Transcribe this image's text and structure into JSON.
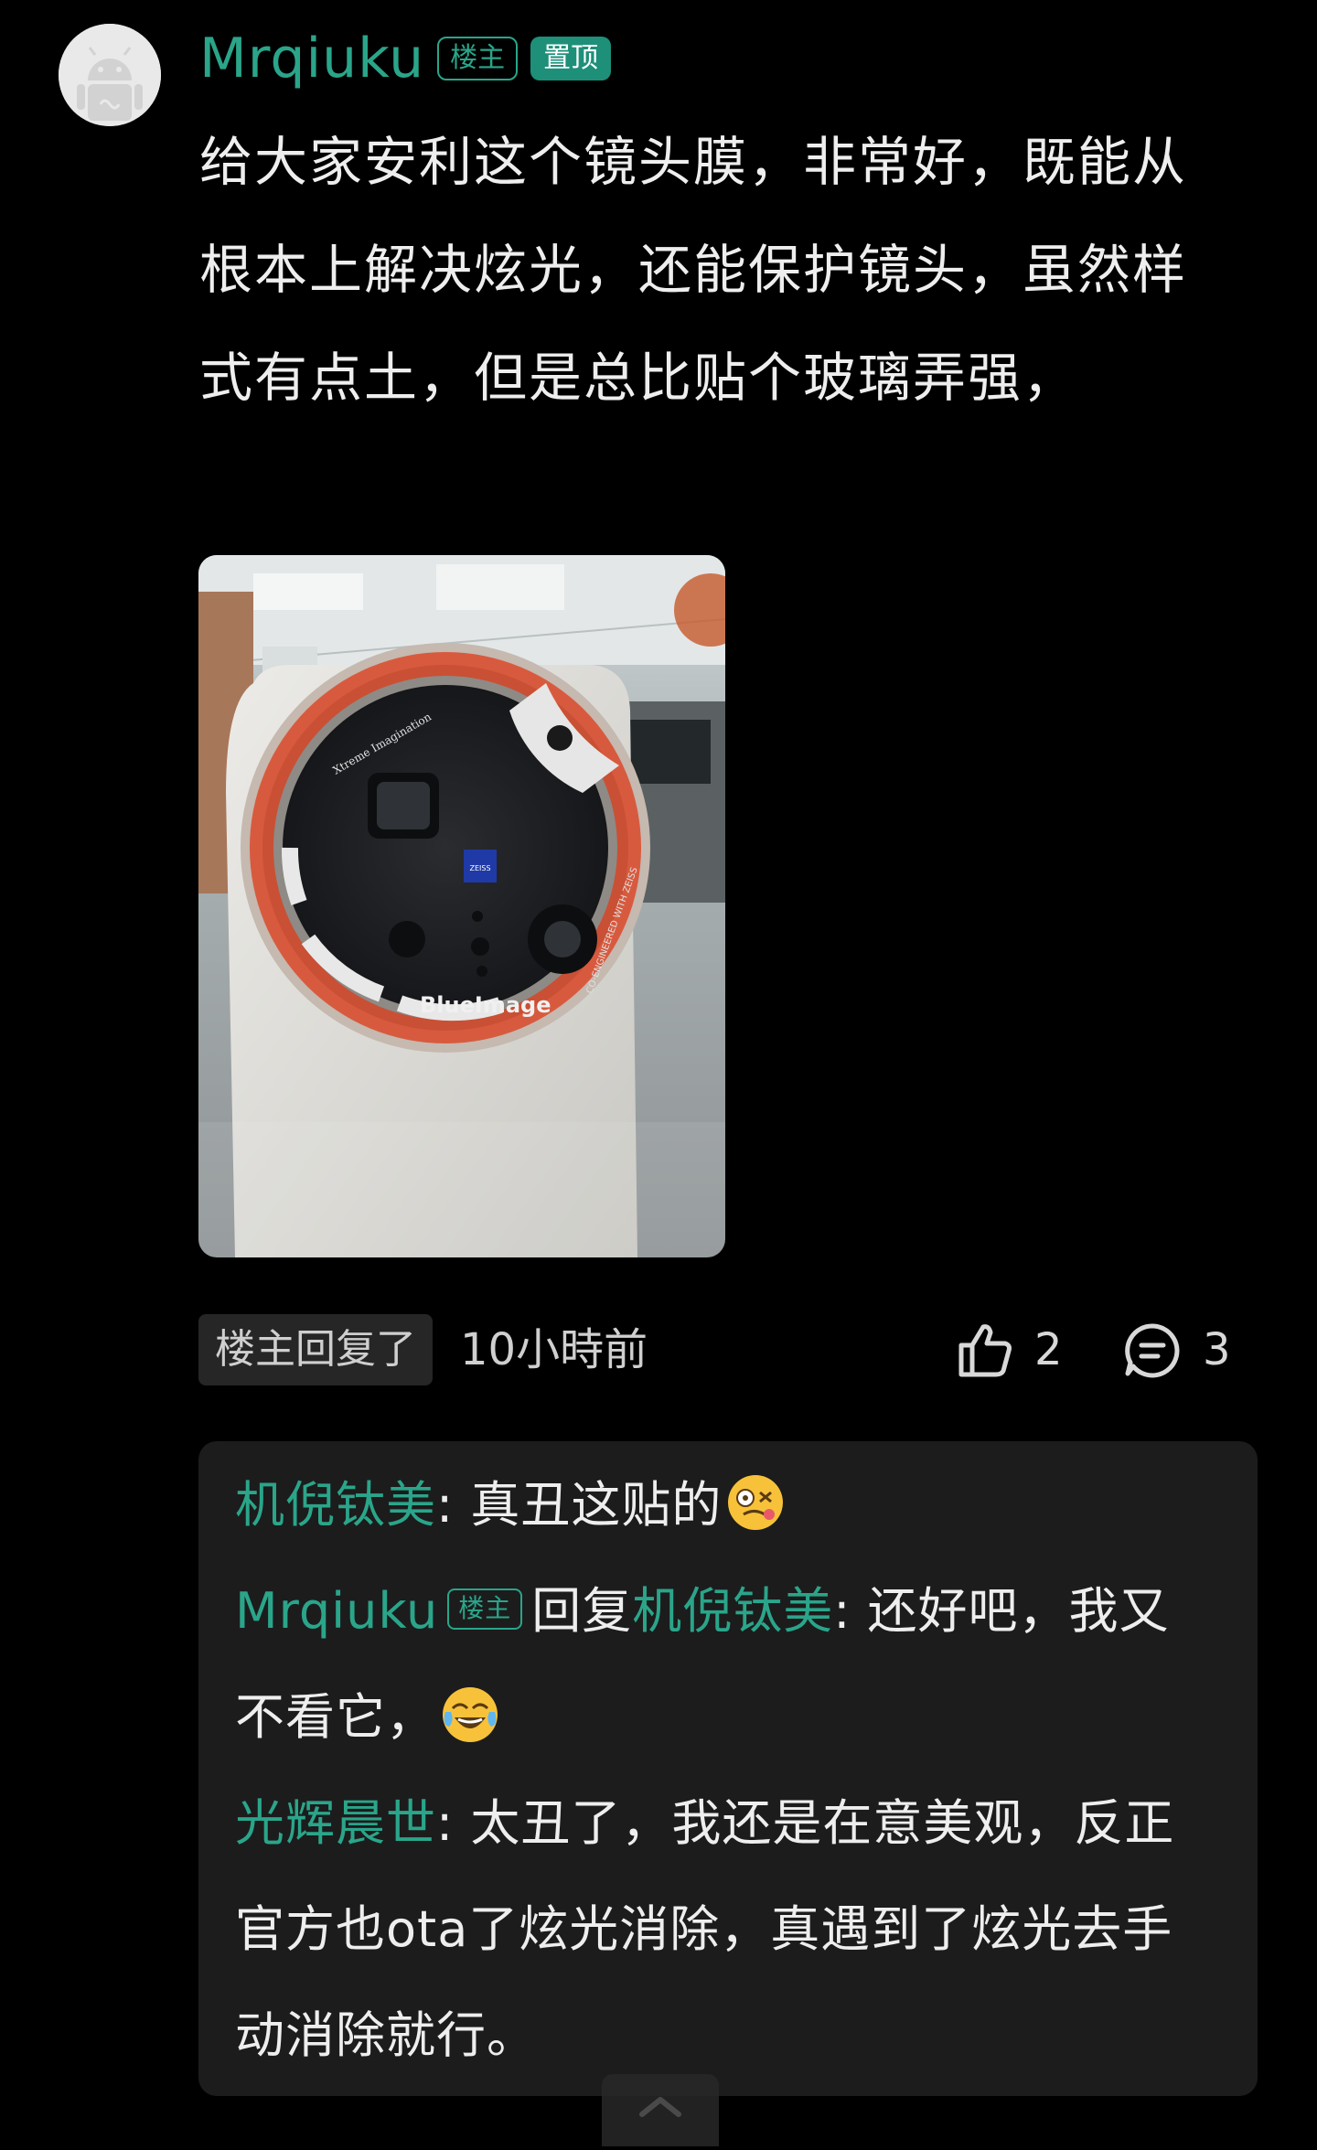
{
  "post": {
    "author": "Mrqiuku",
    "op_badge": "楼主",
    "pin_badge": "置顶",
    "text": "给大家安利这个镜头膜，非常好，既能从根本上解决炫光，还能保护镜头，虽然样式有点土，但是总比贴个玻璃弄强，"
  },
  "image_text": {
    "brand": "BlueImage",
    "zeiss": "ZEISS",
    "ring_top": "Xtreme Imagination",
    "ring_right": "CO-ENGINEERED WITH ZEISS"
  },
  "meta": {
    "op_replied": "楼主回复了",
    "time": "10小時前",
    "likes": "2",
    "comments": "3"
  },
  "replies": [
    {
      "user": "机倪钛美",
      "text": ": 真丑这贴的",
      "emoji": "dizzy-face-emoji"
    },
    {
      "user": "Mrqiuku",
      "badge": "楼主",
      "reply_word": "回复",
      "reply_to": "机倪钛美",
      "text": ": 还好吧，我又不看它，",
      "emoji": "tears-of-joy-emoji"
    },
    {
      "user": "光辉晨世",
      "text": ": 太丑了，我还是在意美观，反正官方也ota了炫光消除，真遇到了炫光去手动消除就行。"
    }
  ],
  "colors": {
    "background": "#000000",
    "username": "#2aa58a",
    "pin_badge_bg": "#1e8f79",
    "reply_box": "#1c1c1c",
    "text": "#eeeeee"
  },
  "icons": [
    "android-avatar-icon",
    "thumbs-up-icon",
    "comment-icon",
    "chevron-up-icon"
  ]
}
